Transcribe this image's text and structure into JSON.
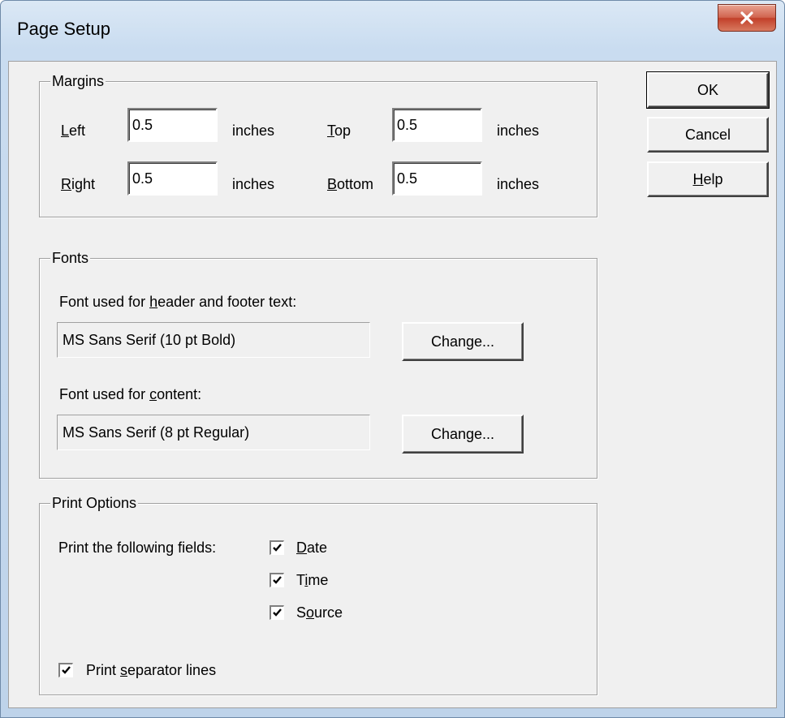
{
  "window": {
    "title": "Page Setup",
    "close_icon": "close-icon"
  },
  "buttons": {
    "ok": "OK",
    "cancel": "Cancel",
    "help": "Help"
  },
  "margins": {
    "title": "Margins",
    "left": {
      "label_u": "L",
      "label_rest": "eft",
      "value": "0.5",
      "unit": "inches"
    },
    "top": {
      "label_u": "T",
      "label_rest": "op",
      "value": "0.5",
      "unit": "inches"
    },
    "right": {
      "label_u": "R",
      "label_rest": "ight",
      "value": "0.5",
      "unit": "inches"
    },
    "bottom": {
      "label_u": "B",
      "label_rest": "ottom",
      "value": "0.5",
      "unit": "inches"
    }
  },
  "fonts": {
    "title": "Fonts",
    "header_label_pre": "Font used for ",
    "header_label_u": "h",
    "header_label_post": "eader and footer text:",
    "header_value": "MS Sans Serif (10 pt Bold)",
    "content_label_pre": "Font used for ",
    "content_label_u": "c",
    "content_label_post": "ontent:",
    "content_value": "MS Sans Serif (8 pt Regular)",
    "change_label": "Change..."
  },
  "print_options": {
    "title": "Print Options",
    "fields_label": "Print the following fields:",
    "date": {
      "u": "D",
      "rest": "ate",
      "checked": true
    },
    "time": {
      "pre": "T",
      "u": "i",
      "rest": "me",
      "checked": true
    },
    "source": {
      "pre": "S",
      "u": "o",
      "rest": "urce",
      "checked": true
    },
    "separator": {
      "pre": "Print ",
      "u": "s",
      "rest": "eparator lines",
      "checked": true
    }
  }
}
